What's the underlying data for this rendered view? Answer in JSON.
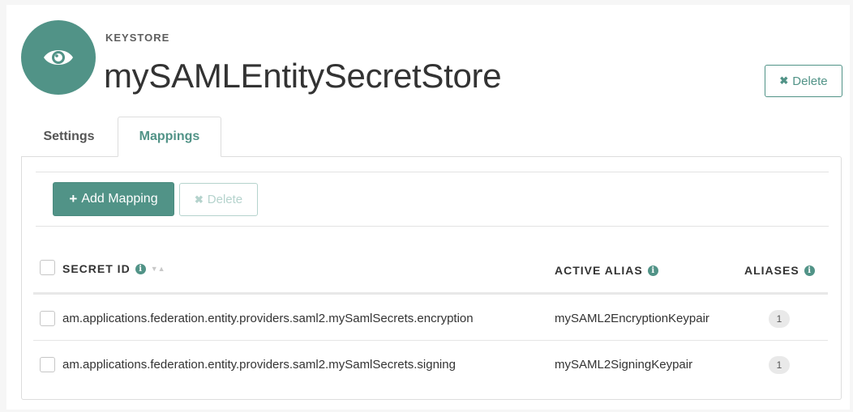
{
  "header": {
    "icon": "eye-icon",
    "eyebrow": "KEYSTORE",
    "title": "mySAMLEntitySecretStore",
    "delete_label": "Delete"
  },
  "tabs": [
    {
      "label": "Settings",
      "active": false
    },
    {
      "label": "Mappings",
      "active": true
    }
  ],
  "toolbar": {
    "add_label": "Add Mapping",
    "delete_label": "Delete"
  },
  "table": {
    "columns": [
      "SECRET ID",
      "ACTIVE ALIAS",
      "ALIASES"
    ],
    "rows": [
      {
        "secret_id": "am.applications.federation.entity.providers.saml2.mySamlSecrets.encryption",
        "active_alias": "mySAML2EncryptionKeypair",
        "aliases": "1"
      },
      {
        "secret_id": "am.applications.federation.entity.providers.saml2.mySamlSecrets.signing",
        "active_alias": "mySAML2SigningKeypair",
        "aliases": "1"
      }
    ]
  },
  "colors": {
    "accent": "#519387",
    "background": "#f6f6f6"
  }
}
